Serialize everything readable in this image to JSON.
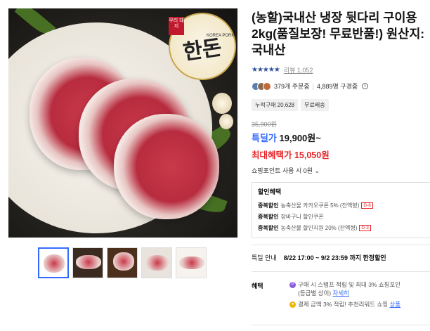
{
  "product": {
    "title": "(농할)국내산 냉장 뒷다리 구이용2kg(품질보장! 무료반품!) 원산지: 국내산",
    "rating_stars": "★★★★★",
    "review_link": "리뷰 1,052",
    "order_count": "379개 주문중",
    "viewers": "4,889명 구경중",
    "badges": [
      {
        "label": "누적구매 20,628"
      },
      {
        "label": "무료배송"
      }
    ],
    "original_price": "35,900원",
    "sale_label": "특딜가",
    "sale_price": "19,900원~",
    "best_price": "최대혜택가 15,050원",
    "points": "쇼핑포인트 사용 시 0원"
  },
  "discounts": {
    "header": "할인혜택",
    "rows": [
      {
        "key": "중복할인",
        "text": "농축산물 카카오쿠폰 5% (잔액형)",
        "tag": "D-8"
      },
      {
        "key": "중복할인",
        "text": "장바구니 할인쿠폰",
        "tag": ""
      },
      {
        "key": "중복할인",
        "text": "농축산물 할인지원 20% (잔액형)",
        "tag": "D-3"
      }
    ]
  },
  "deal": {
    "label": "특딜 안내",
    "value": "8/22 17:00 ~ 9/2 23:59 까지 한정할인"
  },
  "benefit": {
    "label": "혜택",
    "line1": "구매 시 스탬프 적립 및 최대 3% 쇼핑포인",
    "line2": "(등급별 상이)",
    "line2_link": "자세히",
    "line3": "결제 금액 3% 적립! 추천리워드 쇼핑 ",
    "line3_link": "상품"
  },
  "image": {
    "seal_tag": "우리 돼지",
    "seal_brand": "한돈",
    "seal_sub": "KOREA PORK"
  },
  "icons": {
    "info": "info-icon",
    "coin": "point-coin-icon"
  },
  "colors": {
    "accent_blue": "#346aff",
    "accent_red": "#e52528"
  }
}
